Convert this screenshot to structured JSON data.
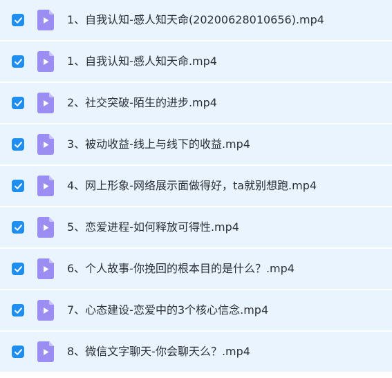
{
  "file_list": {
    "items": [
      {
        "name": "1、自我认知-感人知天命(20200628010656).mp4",
        "checked": true
      },
      {
        "name": "1、自我认知-感人知天命.mp4",
        "checked": true
      },
      {
        "name": "2、社交突破-陌生的进步.mp4",
        "checked": true
      },
      {
        "name": "3、被动收益-线上与线下的收益.mp4",
        "checked": true
      },
      {
        "name": "4、网上形象-网络展示面做得好，ta就别想跑.mp4",
        "checked": true
      },
      {
        "name": "5、恋爱进程-如何释放可得性.mp4",
        "checked": true
      },
      {
        "name": "6、个人故事-你挽回的根本目的是什么？.mp4",
        "checked": true
      },
      {
        "name": "7、心态建设-恋爱中的3个核心信念.mp4",
        "checked": true
      },
      {
        "name": "8、微信文字聊天-你会聊天么？.mp4",
        "checked": true
      }
    ]
  },
  "colors": {
    "row_background": "#eaf4fe",
    "checkbox": "#1f8ef1",
    "file_icon": "#9b8df2",
    "text": "#2b2f36"
  },
  "icons": {
    "checkbox": "checkmark-icon",
    "file": "video-file-icon"
  }
}
